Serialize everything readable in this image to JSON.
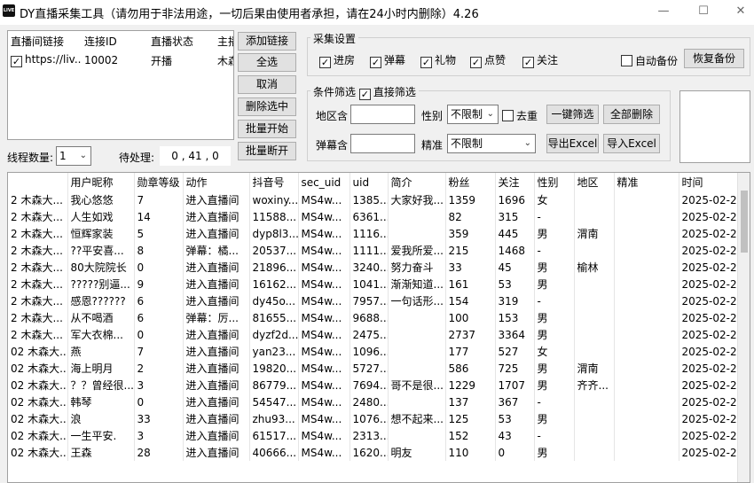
{
  "window": {
    "title": "DY直播采集工具（请勿用于非法用途，一切后果由使用者承担，请在24小时内删除）4.26",
    "icon_text": "LIVE"
  },
  "link_table": {
    "headers": [
      "直播间链接",
      "连接ID",
      "直播状态",
      "主播"
    ],
    "rows": [
      {
        "checked": true,
        "link": "https://liv...",
        "id": "10002",
        "status": "开播",
        "host": "木森"
      }
    ]
  },
  "buttons": {
    "add_link": "添加链接",
    "select_all": "全选",
    "cancel": "取消",
    "delete_selected": "删除选中",
    "batch_start": "批量开始",
    "batch_disconnect": "批量断开",
    "filter": "一键筛选",
    "delete_all": "全部删除",
    "export_excel": "导出Excel",
    "import_excel": "导入Excel",
    "restore_backup": "恢复备份"
  },
  "threads": {
    "label": "线程数量:",
    "value": "1",
    "pending_label": "待处理:",
    "pending_value": "0 , 41 , 0"
  },
  "collect_settings": {
    "title": "采集设置",
    "options": [
      {
        "label": "进房",
        "checked": true
      },
      {
        "label": "弹幕",
        "checked": true
      },
      {
        "label": "礼物",
        "checked": true
      },
      {
        "label": "点赞",
        "checked": true
      },
      {
        "label": "关注",
        "checked": true
      }
    ],
    "auto_backup": {
      "label": "自动备份",
      "checked": false
    }
  },
  "filter": {
    "title": "条件筛选",
    "direct_filter": {
      "label": "直接筛选",
      "checked": true
    },
    "region_label": "地区含",
    "region_value": "",
    "gender_label": "性别",
    "gender_value": "不限制",
    "dedupe": {
      "label": "去重",
      "checked": false
    },
    "danmu_label": "弹幕含",
    "danmu_value": "",
    "precise_label": "精准",
    "precise_value": "不限制"
  },
  "grid": {
    "headers": [
      "",
      "用户昵称",
      "勋章等级",
      "动作",
      "抖音号",
      "sec_uid",
      "uid",
      "简介",
      "粉丝",
      "关注",
      "性别",
      "地区",
      "精准",
      "时间"
    ],
    "rows": [
      [
        "2 木森大...",
        "我心悠悠",
        "7",
        "进入直播间",
        "woxiny...",
        "MS4w...",
        "1385...",
        "大家好我...",
        "1359",
        "1696",
        "女",
        "",
        "",
        "2025-02-2..."
      ],
      [
        "2 木森大...",
        "人生如戏",
        "14",
        "进入直播间",
        "11588...",
        "MS4w...",
        "6361...",
        "",
        "82",
        "315",
        "-",
        "",
        "",
        "2025-02-2..."
      ],
      [
        "2 木森大...",
        "恒辉家装",
        "5",
        "进入直播间",
        "dyp8l3...",
        "MS4w...",
        "1116...",
        "",
        "359",
        "445",
        "男",
        "渭南",
        "",
        "2025-02-2..."
      ],
      [
        "2 木森大...",
        "??平安喜...",
        "8",
        "弹幕：橘...",
        "20537...",
        "MS4w...",
        "1111...",
        "爱我所爱...",
        "215",
        "1468",
        "-",
        "",
        "",
        "2025-02-2..."
      ],
      [
        "2 木森大...",
        "80大院院长",
        "0",
        "进入直播间",
        "21896...",
        "MS4w...",
        "3240...",
        "努力奋斗",
        "33",
        "45",
        "男",
        "榆林",
        "",
        "2025-02-2..."
      ],
      [
        "2 木森大...",
        "?????别逼...",
        "9",
        "进入直播间",
        "16162...",
        "MS4w...",
        "1041...",
        "渐渐知道...",
        "161",
        "53",
        "男",
        "",
        "",
        "2025-02-2..."
      ],
      [
        "2 木森大...",
        "感恩??????",
        "6",
        "进入直播间",
        "dy45o...",
        "MS4w...",
        "7957...",
        "一句话形...",
        "154",
        "319",
        "-",
        "",
        "",
        "2025-02-2..."
      ],
      [
        "2 木森大...",
        "从不喝酒",
        "6",
        "弹幕：厉...",
        "81655...",
        "MS4w...",
        "9688...",
        "",
        "100",
        "153",
        "男",
        "",
        "",
        "2025-02-2..."
      ],
      [
        "2 木森大...",
        "军大衣棉...",
        "0",
        "进入直播间",
        "dyzf2d...",
        "MS4w...",
        "2475...",
        "",
        "2737",
        "3364",
        "男",
        "",
        "",
        "2025-02-2..."
      ],
      [
        "02 木森大...",
        "燕",
        "7",
        "进入直播间",
        "yan23...",
        "MS4w...",
        "1096...",
        "",
        "177",
        "527",
        "女",
        "",
        "",
        "2025-02-2..."
      ],
      [
        "02 木森大...",
        "海上明月",
        "2",
        "进入直播间",
        "19820...",
        "MS4w...",
        "5727...",
        "",
        "586",
        "725",
        "男",
        "渭南",
        "",
        "2025-02-2..."
      ],
      [
        "02 木森大...",
        "？？曾经很...",
        "3",
        "进入直播间",
        "86779...",
        "MS4w...",
        "7694...",
        "哥不是很...",
        "1229",
        "1707",
        "男",
        "齐齐...",
        "",
        "2025-02-2..."
      ],
      [
        "02 木森大...",
        "韩琴",
        "0",
        "进入直播间",
        "54547...",
        "MS4w...",
        "2480...",
        "",
        "137",
        "367",
        "-",
        "",
        "",
        "2025-02-2..."
      ],
      [
        "02 木森大...",
        "浪",
        "33",
        "进入直播间",
        "zhu93...",
        "MS4w...",
        "1076...",
        "想不起来...",
        "125",
        "53",
        "男",
        "",
        "",
        "2025-02-2..."
      ],
      [
        "02 木森大...",
        "一生平安.",
        "3",
        "进入直播间",
        "61517...",
        "MS4w...",
        "2313...",
        "",
        "152",
        "43",
        "-",
        "",
        "",
        "2025-02-2..."
      ],
      [
        "02 木森大...",
        "王森",
        "28",
        "进入直播间",
        "40666...",
        "MS4w...",
        "1620...",
        "明友",
        "110",
        "0",
        "男",
        "",
        "",
        "2025-02-2..."
      ]
    ]
  }
}
